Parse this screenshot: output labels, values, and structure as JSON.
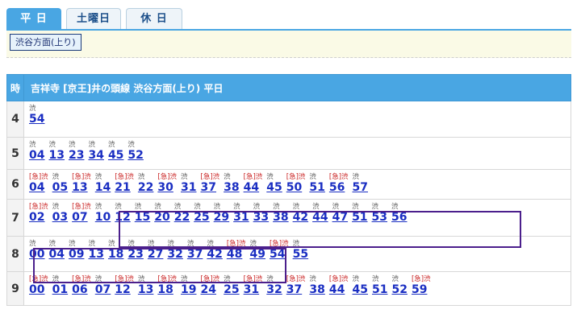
{
  "tabs": [
    {
      "label": "平 日",
      "active": true
    },
    {
      "label": "土曜日",
      "active": false
    },
    {
      "label": "休 日",
      "active": false
    }
  ],
  "direction_label": "渋谷方面(上り)",
  "table": {
    "hour_header": "時",
    "title": "吉祥寺 [京王]井の頭線 渋谷方面(上り) 平日",
    "rows": [
      {
        "hour": "4",
        "deps": [
          {
            "k": "渋",
            "m": "54"
          }
        ]
      },
      {
        "hour": "5",
        "deps": [
          {
            "k": "渋",
            "m": "04"
          },
          {
            "k": "渋",
            "m": "13"
          },
          {
            "k": "渋",
            "m": "23"
          },
          {
            "k": "渋",
            "m": "34"
          },
          {
            "k": "渋",
            "m": "45"
          },
          {
            "k": "渋",
            "m": "52"
          }
        ]
      },
      {
        "hour": "6",
        "deps": [
          {
            "k": "[急]渋",
            "m": "04"
          },
          {
            "k": "渋",
            "m": "05"
          },
          {
            "k": "[急]渋",
            "m": "13"
          },
          {
            "k": "渋",
            "m": "14"
          },
          {
            "k": "[急]渋",
            "m": "21"
          },
          {
            "k": "渋",
            "m": "22"
          },
          {
            "k": "[急]渋",
            "m": "30"
          },
          {
            "k": "渋",
            "m": "31"
          },
          {
            "k": "[急]渋",
            "m": "37"
          },
          {
            "k": "渋",
            "m": "38"
          },
          {
            "k": "[急]渋",
            "m": "44"
          },
          {
            "k": "渋",
            "m": "45"
          },
          {
            "k": "[急]渋",
            "m": "50"
          },
          {
            "k": "渋",
            "m": "51"
          },
          {
            "k": "[急]渋",
            "m": "56"
          },
          {
            "k": "渋",
            "m": "57"
          }
        ]
      },
      {
        "hour": "7",
        "deps": [
          {
            "k": "[急]渋",
            "m": "02"
          },
          {
            "k": "渋",
            "m": "03"
          },
          {
            "k": "[急]渋",
            "m": "07"
          },
          {
            "k": "渋",
            "m": "10"
          },
          {
            "k": "渋",
            "m": "12"
          },
          {
            "k": "渋",
            "m": "15"
          },
          {
            "k": "渋",
            "m": "20"
          },
          {
            "k": "渋",
            "m": "22"
          },
          {
            "k": "渋",
            "m": "25"
          },
          {
            "k": "渋",
            "m": "29"
          },
          {
            "k": "渋",
            "m": "31"
          },
          {
            "k": "渋",
            "m": "33"
          },
          {
            "k": "渋",
            "m": "38"
          },
          {
            "k": "渋",
            "m": "42"
          },
          {
            "k": "渋",
            "m": "44"
          },
          {
            "k": "渋",
            "m": "47"
          },
          {
            "k": "渋",
            "m": "51"
          },
          {
            "k": "渋",
            "m": "53"
          },
          {
            "k": "渋",
            "m": "56"
          }
        ]
      },
      {
        "hour": "8",
        "deps": [
          {
            "k": "渋",
            "m": "00"
          },
          {
            "k": "渋",
            "m": "04"
          },
          {
            "k": "渋",
            "m": "09"
          },
          {
            "k": "渋",
            "m": "13"
          },
          {
            "k": "渋",
            "m": "18"
          },
          {
            "k": "渋",
            "m": "23"
          },
          {
            "k": "渋",
            "m": "27"
          },
          {
            "k": "渋",
            "m": "32"
          },
          {
            "k": "渋",
            "m": "37"
          },
          {
            "k": "渋",
            "m": "42"
          },
          {
            "k": "[急]渋",
            "m": "48"
          },
          {
            "k": "渋",
            "m": "49"
          },
          {
            "k": "[急]渋",
            "m": "54"
          },
          {
            "k": "渋",
            "m": "55"
          }
        ]
      },
      {
        "hour": "9",
        "deps": [
          {
            "k": "[急]渋",
            "m": "00"
          },
          {
            "k": "渋",
            "m": "01"
          },
          {
            "k": "[急]渋",
            "m": "06"
          },
          {
            "k": "渋",
            "m": "07"
          },
          {
            "k": "[急]渋",
            "m": "12"
          },
          {
            "k": "渋",
            "m": "13"
          },
          {
            "k": "[急]渋",
            "m": "18"
          },
          {
            "k": "渋",
            "m": "19"
          },
          {
            "k": "[急]渋",
            "m": "24"
          },
          {
            "k": "渋",
            "m": "25"
          },
          {
            "k": "[急]渋",
            "m": "31"
          },
          {
            "k": "渋",
            "m": "32"
          },
          {
            "k": "[急]渋",
            "m": "37"
          },
          {
            "k": "渋",
            "m": "38"
          },
          {
            "k": "[急]渋",
            "m": "44"
          },
          {
            "k": "渋",
            "m": "45"
          },
          {
            "k": "渋",
            "m": "51"
          },
          {
            "k": "渋",
            "m": "52"
          },
          {
            "k": "[急]渋",
            "m": "59"
          }
        ]
      }
    ]
  },
  "colors": {
    "header_blue": "#49a6e3",
    "minute_link": "#1a2ec2",
    "express_red": "#c81e1e",
    "highlight_box": "#4b1f8c"
  }
}
